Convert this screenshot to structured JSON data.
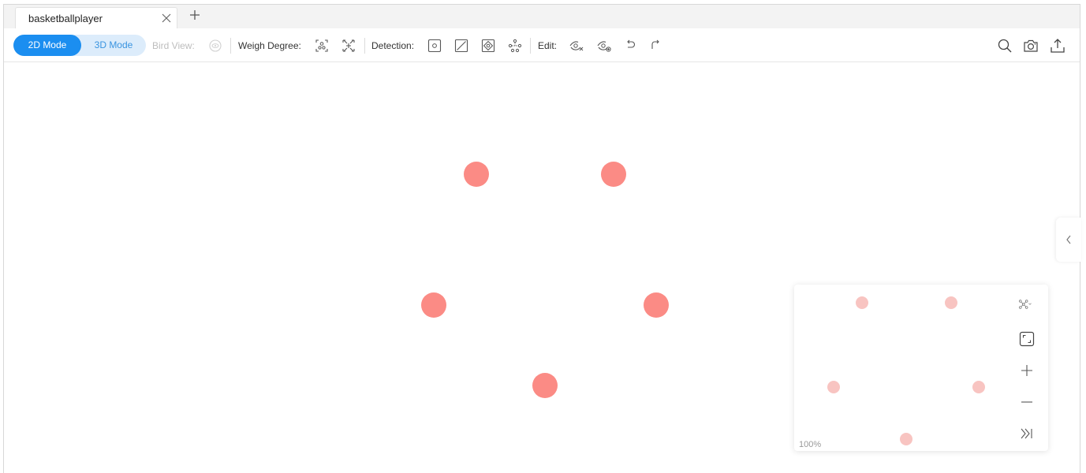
{
  "tab": {
    "title": "basketballplayer"
  },
  "toolbar": {
    "mode_2d": "2D Mode",
    "mode_3d": "3D Mode",
    "bird_view_label": "Bird View:",
    "weigh_degree_label": "Weigh Degree:",
    "detection_label": "Detection:",
    "edit_label": "Edit:"
  },
  "colors": {
    "accent": "#1b8ef0",
    "node": "#fb8b85",
    "mini_node": "#f8c4c1"
  },
  "minimap": {
    "zoom": "100%"
  }
}
